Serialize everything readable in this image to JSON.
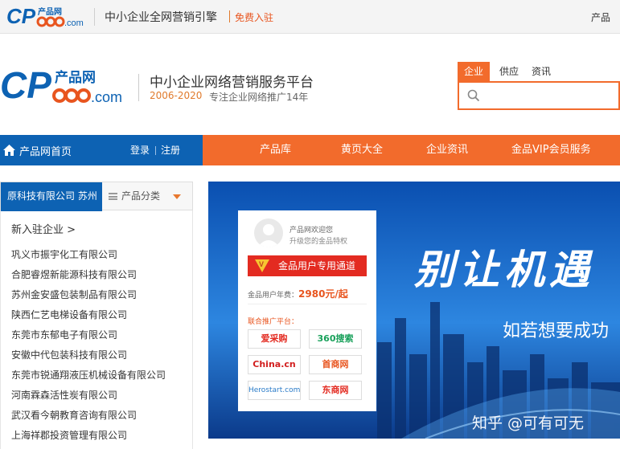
{
  "topbar": {
    "logo_text": "CP产品网 008.com",
    "slogan": "中小企业全网营销引擎",
    "free_join": "免费入驻",
    "right_link": "产品"
  },
  "header": {
    "logo_text": "CP产品网 008.com",
    "title": "中小企业网络营销服务平台",
    "years": "2006-2020",
    "since": "专注企业网络推广14年"
  },
  "search": {
    "tabs": [
      "企业",
      "供应",
      "资讯"
    ],
    "active_tab": "企业",
    "placeholder": "",
    "value": ""
  },
  "nav": {
    "home": "产品网首页",
    "login": "登录",
    "register": "注册",
    "items": [
      "产品库",
      "黄页大全",
      "企业资讯",
      "金品VIP会员服务"
    ]
  },
  "sidebar": {
    "company_tag": "原科技有限公司 苏州",
    "category_label": "产品分类",
    "new_label": "新入驻企业 >",
    "companies": [
      "巩义市振宇化工有限公司",
      "合肥睿煜新能源科技有限公司",
      "苏州金安盛包装制品有限公司",
      "陕西仁艺电梯设备有限公司",
      "东莞市东郁电子有限公司",
      "安徽中代包装科技有限公司",
      "东莞市锐通翔液压机械设备有限公司",
      "河南霖森活性炭有限公司",
      "武汉看今朝教育咨询有限公司",
      "上海祥郡投资管理有限公司"
    ]
  },
  "banner": {
    "headline": "别让机遇",
    "subline": "如若想要成功",
    "watermark": "知乎 @可有可无"
  },
  "card": {
    "welcome": "产品网欢迎您",
    "upgrade": "升级您的金品特权",
    "button": "金品用户专用通道",
    "fee_label": "金品用户年费：",
    "fee_value": "2980元/起",
    "partners_label": "联合推广平台：",
    "partners": [
      "爱采购",
      "360搜索",
      "China.cn",
      "首商网",
      "Herostart.com",
      "东商网"
    ]
  },
  "colors": {
    "brand_blue": "#0d62b3",
    "brand_orange": "#f26b2c",
    "card_red": "#e32b21"
  }
}
